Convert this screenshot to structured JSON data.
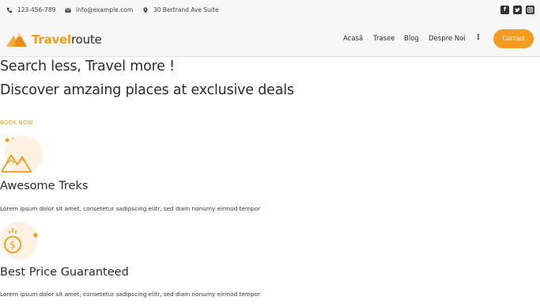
{
  "topbar": {
    "phone": "123-456-789",
    "email": "info@example.com",
    "address": "30 Bertrand Ave Suite",
    "socials": [
      "facebook-icon",
      "twitter-icon",
      "instagram-icon"
    ]
  },
  "header": {
    "logo_part1": "Travel",
    "logo_part2": "route",
    "nav": [
      "Acasă",
      "Trasee",
      "Blog",
      "Despre Noi"
    ],
    "more_label": "⁝",
    "contact_label": "Contact"
  },
  "hero": {
    "title": "Search less, Travel more !",
    "subtitle": "Discover amzaing places at exclusive deals",
    "cta": "BOOK NOW"
  },
  "features": [
    {
      "icon": "mountains-icon",
      "title": "Awesome Treks",
      "description": "Lorem ipsum dolor sit amet, consetetur sadipscing elitr, sed diam nonumy eirmod tempor"
    },
    {
      "icon": "dollar-coin-icon",
      "title": "Best Price Guaranteed",
      "description": "Lorem ipsum dolor sit amet, consetetur sadipscing elitr, sed diam nonumy eirmod tempor"
    }
  ],
  "colors": {
    "accent": "#f39c1f",
    "text": "#2b2b2b",
    "bar_bg": "#f7f7f7"
  }
}
